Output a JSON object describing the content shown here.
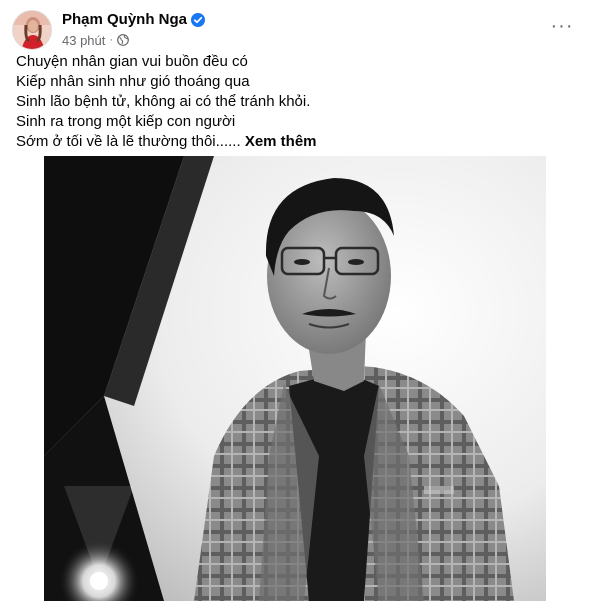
{
  "author": {
    "name": "Phạm Quỳnh Nga",
    "verified": true,
    "avatar_icon": "profile-avatar"
  },
  "meta": {
    "time": "43 phút",
    "separator": "·",
    "privacy_icon": "globe-icon"
  },
  "menu": {
    "icon": "more-horizontal-icon",
    "label": "···"
  },
  "post_text": {
    "lines": [
      "Chuyện nhân gian vui buồn đều có",
      "Kiếp nhân sinh như gió thoáng qua",
      "Sinh lão bệnh tử, không ai có thể tránh khỏi.",
      "Sinh ra trong một kiếp con người",
      "Sớm ở tối về là lẽ thường thôi......"
    ],
    "see_more": "Xem thêm"
  },
  "photo": {
    "description_icon": "black-and-white-portrait-photo",
    "style": "black and white"
  },
  "colors": {
    "text_primary": "#050505",
    "text_secondary": "#65676b",
    "verified_blue": "#1877f2"
  }
}
